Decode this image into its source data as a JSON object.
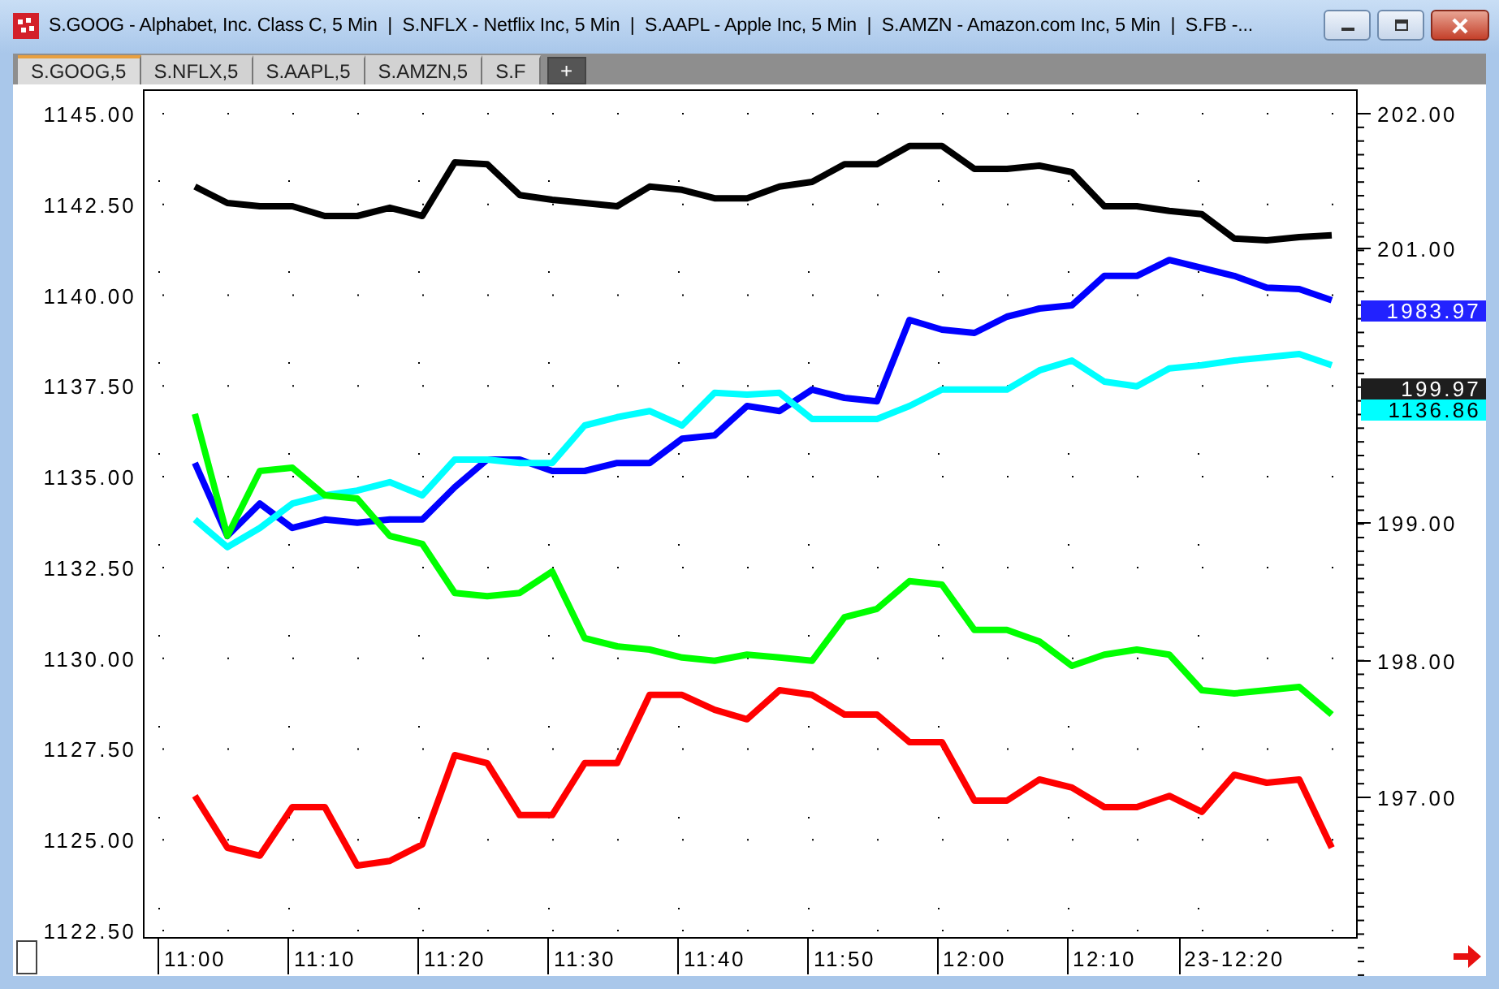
{
  "window": {
    "title": "S.GOOG - Alphabet, Inc. Class C, 5 Min  |  S.NFLX - Netflix Inc, 5 Min  |  S.AAPL - Apple Inc, 5 Min  |  S.AMZN - Amazon.com Inc, 5 Min  |  S.FB -..."
  },
  "tabs": [
    {
      "label": "S.GOOG,5",
      "selected": true
    },
    {
      "label": "S.NFLX,5",
      "selected": false
    },
    {
      "label": "S.AAPL,5",
      "selected": false
    },
    {
      "label": "S.AMZN,5",
      "selected": false
    },
    {
      "label": "S.F",
      "selected": false
    }
  ],
  "add_tab": "+",
  "chart": {
    "chart_data": {
      "type": "line",
      "categories": [
        "11:00",
        null,
        null,
        null,
        "11:10",
        null,
        null,
        null,
        "11:20",
        null,
        null,
        null,
        "11:30",
        null,
        null,
        null,
        "11:40",
        null,
        null,
        null,
        "11:50",
        null,
        null,
        null,
        "12:00",
        null,
        null,
        null,
        "12:10",
        null,
        null,
        null,
        "23-12:20",
        null,
        null,
        null
      ],
      "ylim": [
        1122.5,
        1145
      ],
      "grid": true,
      "yticks": [
        {
          "value": 1145,
          "label": "1145.00"
        },
        {
          "value": 1142.5,
          "label": "1142.50"
        },
        {
          "value": 1140,
          "label": "1140.00"
        },
        {
          "value": 1137.5,
          "label": "1137.50"
        },
        {
          "value": 1135,
          "label": "1135.00"
        },
        {
          "value": 1132.5,
          "label": "1132.50"
        },
        {
          "value": 1130,
          "label": "1130.00"
        },
        {
          "value": 1127.5,
          "label": "1127.50"
        },
        {
          "value": 1125,
          "label": "1125.00"
        },
        {
          "value": 1122.5,
          "label": "1122.50"
        }
      ],
      "series": [
        {
          "color": "#000000",
          "values": [
            1142.99,
            1142.54,
            1142.45,
            1142.45,
            1142.18,
            1142.18,
            1142.41,
            1142.18,
            1143.66,
            1143.61,
            1142.76,
            1142.63,
            1142.54,
            1142.45,
            1142.99,
            1142.9,
            1142.67,
            1142.67,
            1142.99,
            1143.12,
            1143.61,
            1143.61,
            1144.11,
            1144.11,
            1143.48,
            1143.48,
            1143.57,
            1143.39,
            1142.45,
            1142.45,
            1142.32,
            1142.23,
            1141.56,
            1141.51,
            1141.6,
            1141.65
          ]
        },
        {
          "color": "#0000ff",
          "values": [
            1135.38,
            1133.37,
            1134.26,
            1133.59,
            1133.82,
            1133.73,
            1133.82,
            1133.82,
            1134.71,
            1135.47,
            1135.47,
            1135.16,
            1135.16,
            1135.38,
            1135.38,
            1136.05,
            1136.14,
            1136.95,
            1136.81,
            1137.4,
            1137.17,
            1137.08,
            1139.32,
            1139.05,
            1138.96,
            1139.41,
            1139.63,
            1139.72,
            1140.53,
            1140.53,
            1140.97,
            1140.75,
            1140.53,
            1140.21,
            1140.17,
            1139.86
          ]
        },
        {
          "color": "#00ffff",
          "values": [
            1133.82,
            1133.06,
            1133.59,
            1134.26,
            1134.49,
            1134.62,
            1134.85,
            1134.49,
            1135.47,
            1135.47,
            1135.38,
            1135.38,
            1136.41,
            1136.64,
            1136.81,
            1136.41,
            1137.31,
            1137.26,
            1137.31,
            1136.59,
            1136.59,
            1136.59,
            1136.95,
            1137.4,
            1137.4,
            1137.4,
            1137.93,
            1138.2,
            1137.62,
            1137.49,
            1137.98,
            1138.07,
            1138.2,
            1138.29,
            1138.38,
            1138.07
          ]
        },
        {
          "color": "#00ff00",
          "values": [
            1136.73,
            1133.37,
            1135.16,
            1135.25,
            1134.49,
            1134.4,
            1133.37,
            1133.15,
            1131.8,
            1131.71,
            1131.8,
            1132.39,
            1130.55,
            1130.33,
            1130.24,
            1130.02,
            1129.93,
            1130.1,
            1130.02,
            1129.93,
            1131.13,
            1131.36,
            1132.12,
            1132.03,
            1130.78,
            1130.78,
            1130.46,
            1129.79,
            1130.1,
            1130.24,
            1130.1,
            1129.12,
            1129.03,
            1129.12,
            1129.21,
            1128.45
          ]
        },
        {
          "color": "#ff0000",
          "values": [
            1126.21,
            1124.78,
            1124.56,
            1125.9,
            1125.9,
            1124.29,
            1124.42,
            1124.87,
            1127.33,
            1127.11,
            1125.68,
            1125.68,
            1127.11,
            1127.11,
            1128.99,
            1128.99,
            1128.58,
            1128.32,
            1129.12,
            1128.99,
            1128.45,
            1128.45,
            1127.69,
            1127.69,
            1126.08,
            1126.08,
            1126.66,
            1126.44,
            1125.9,
            1125.9,
            1126.21,
            1125.77,
            1126.79,
            1126.57,
            1126.66,
            1124.78
          ]
        }
      ]
    },
    "right_axis": {
      "ticks": [
        "202.00",
        "201.00",
        "199.00",
        "198.00",
        "197.00"
      ]
    },
    "price_tags": [
      {
        "text": "1983.97",
        "color": "#2222ff"
      },
      {
        "text": "199.97",
        "color": "#1e1e1e"
      },
      {
        "text": "1136.86",
        "color": "#00ffff"
      }
    ]
  }
}
